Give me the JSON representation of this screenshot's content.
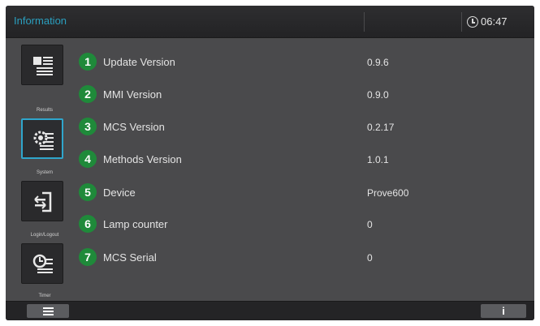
{
  "header": {
    "title": "Information",
    "time": "06:47",
    "time_icon": "clock-icon"
  },
  "sidebar": {
    "items": [
      {
        "label": "Results",
        "icon": "results-icon",
        "active": false
      },
      {
        "label": "System",
        "icon": "system-settings-icon",
        "active": true
      },
      {
        "label": "Login/Logout",
        "icon": "login-logout-icon",
        "active": false
      },
      {
        "label": "Timer",
        "icon": "timer-icon",
        "active": false
      }
    ]
  },
  "info_rows": [
    {
      "num": "1",
      "label": "Update Version",
      "value": "0.9.6"
    },
    {
      "num": "2",
      "label": "MMI Version",
      "value": "0.9.0"
    },
    {
      "num": "3",
      "label": "MCS Version",
      "value": "0.2.17"
    },
    {
      "num": "4",
      "label": "Methods Version",
      "value": "1.0.1"
    },
    {
      "num": "5",
      "label": "Device",
      "value": "Prove600"
    },
    {
      "num": "6",
      "label": "Lamp counter",
      "value": "0"
    },
    {
      "num": "7",
      "label": "MCS Serial",
      "value": "0"
    }
  ],
  "bottombar": {
    "menu_icon": "hamburger-menu-icon",
    "info_label": "i"
  },
  "colors": {
    "accent": "#2fa6cc",
    "badge": "#1f8a3a",
    "background": "#4a4a4c",
    "header": "#2a2a2c"
  }
}
